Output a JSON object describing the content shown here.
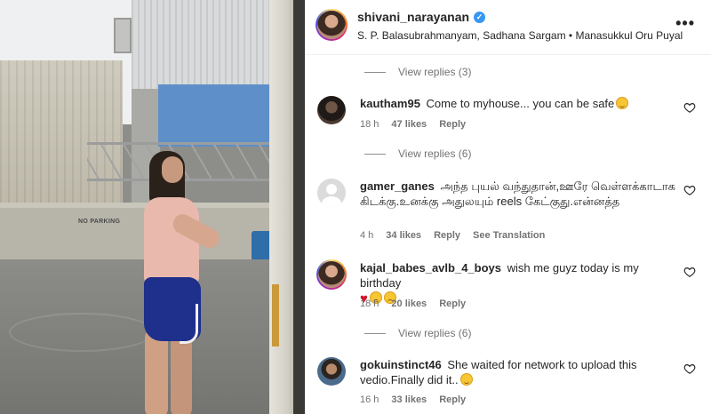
{
  "post": {
    "username": "shivani_narayanan",
    "verified": true,
    "audio": "S. P. Balasubrahmanyam, Sadhana Sargam • Manasukkul Oru Puyal",
    "more_icon": "more-horizontal-icon",
    "media_sign": "NO PARKING"
  },
  "replies_groups": [
    {
      "label": "View replies (3)"
    },
    {
      "label": "View replies (6)"
    },
    {
      "label": "View replies (6)"
    }
  ],
  "comments": [
    {
      "username": "kautham95",
      "text": "Come to myhouse... you can be safe",
      "emojis": [
        "grinning-face-with-sweat"
      ],
      "time": "18 h",
      "likes": "47 likes",
      "reply": "Reply",
      "extra": ""
    },
    {
      "username": "gamer_ganes",
      "text": "அந்த புயல் வந்துதான்,ஊரே வெள்ளக்காடாக கிடக்கு.உனக்கு அதுலயும் reels கேட்குது.என்னத்த",
      "emojis": [],
      "time": "4 h",
      "likes": "34 likes",
      "reply": "Reply",
      "extra": "See Translation"
    },
    {
      "username": "kajal_babes_avlb_4_boys",
      "text": "wish me guyz today is my birthday",
      "emojis": [
        "red-heart",
        "sad-face",
        "sad-face"
      ],
      "time": "18 h",
      "likes": "20 likes",
      "reply": "Reply",
      "extra": ""
    },
    {
      "username": "gokuinstinct46",
      "text": "She waited for network to upload this vedio.Finally did it..",
      "emojis": [
        "grinning-face-with-sweat"
      ],
      "time": "16 h",
      "likes": "33 likes",
      "reply": "Reply",
      "extra": ""
    }
  ],
  "colors": {
    "verified": "#3897f0",
    "meta_text": "#737373",
    "primary_text": "#262626"
  }
}
